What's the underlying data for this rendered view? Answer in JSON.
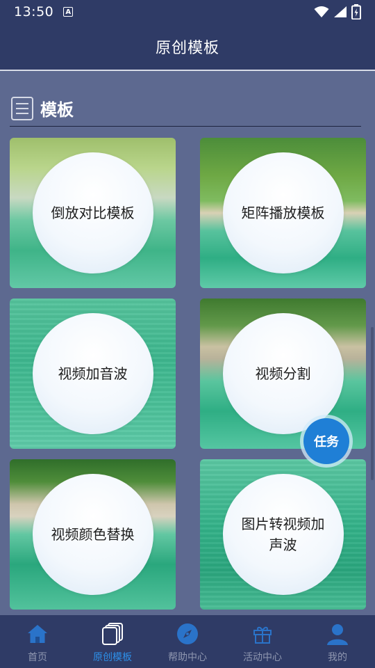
{
  "status_bar": {
    "time": "13:50",
    "indicator": "A"
  },
  "app_bar": {
    "title": "原创模板"
  },
  "section": {
    "title": "模板",
    "icon": "list-icon"
  },
  "templates": [
    {
      "label": "倒放对比模板"
    },
    {
      "label": "矩阵播放模板"
    },
    {
      "label": "视频加音波"
    },
    {
      "label": "视频分割"
    },
    {
      "label": "视频颜色替换"
    },
    {
      "label": "图片转视频加声波"
    }
  ],
  "task_button": {
    "label": "任务"
  },
  "bottom_nav": {
    "items": [
      {
        "label": "首页",
        "icon": "home-icon",
        "active": false
      },
      {
        "label": "原创模板",
        "icon": "template-stack-icon",
        "active": true
      },
      {
        "label": "帮助中心",
        "icon": "compass-icon",
        "active": false
      },
      {
        "label": "活动中心",
        "icon": "gift-icon",
        "active": false
      },
      {
        "label": "我的",
        "icon": "user-icon",
        "active": false
      }
    ]
  },
  "colors": {
    "bar_background": "#2f3b66",
    "page_background": "#5d6990",
    "active_tab": "#2d8fe8",
    "inactive_tab": "#8f97b0",
    "task_button": "#1f7fd6"
  }
}
